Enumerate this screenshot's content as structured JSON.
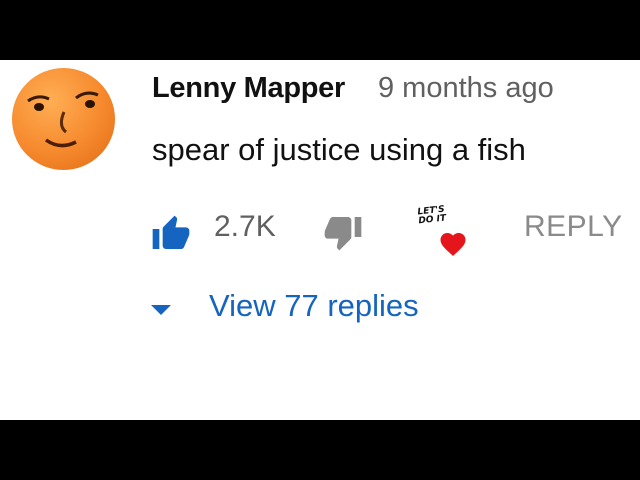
{
  "comment": {
    "author": "Lenny Mapper",
    "timestamp": "9 months ago",
    "text": "spear of justice using a fish",
    "avatar_icon": "lenny-face-avatar",
    "avatar_color": "#f6892d"
  },
  "actions": {
    "like_icon": "thumbs-up-icon",
    "like_count": "2.7K",
    "like_color": "#1565c0",
    "dislike_icon": "thumbs-down-icon",
    "creator_heart_label": "LET'S\nDO IT",
    "heart_color": "#e5161b",
    "reply_label": "REPLY"
  },
  "replies": {
    "toggle_icon": "caret-down-icon",
    "label": "View 77 replies",
    "color": "#1565c0"
  }
}
